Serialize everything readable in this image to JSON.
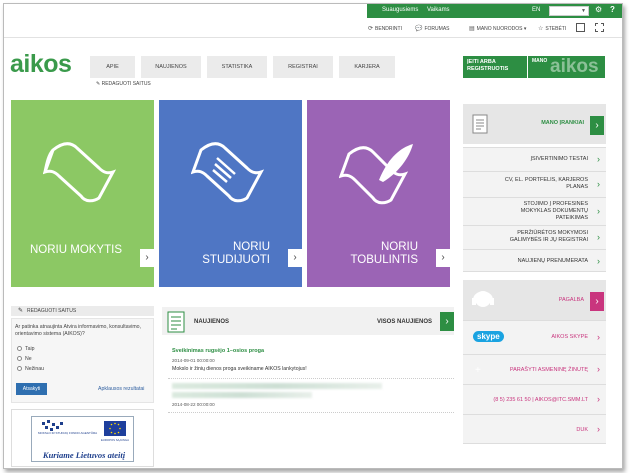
{
  "topbar": {
    "links": [
      "Suaugusiems",
      "Vaikams",
      "EN"
    ],
    "settings_icon": "gear-icon",
    "help_label": "?"
  },
  "subbar": {
    "share_label": "BENDRINTI",
    "forums_label": "FORUMAS",
    "my_links_label": "MANO NUORODOS",
    "follow_label": "STEBĖTI"
  },
  "brand": {
    "logo": "aikos"
  },
  "nav": {
    "items": [
      "APIE",
      "NAUJIENOS",
      "STATISTIKA",
      "REGISTRAI",
      "KARJERA"
    ],
    "edit_label": "REDAGUOTI SAITUS"
  },
  "login": {
    "label": "ĮEITI ARBA REGISTRUOTIS"
  },
  "mano": {
    "label": "MANO",
    "watermark": "aikos"
  },
  "tiles": [
    {
      "title_lines": [
        "NORIU MOKYTIS"
      ],
      "color": "#8cc864"
    },
    {
      "title_lines": [
        "NORIU",
        "STUDIJUOTI"
      ],
      "color": "#4f76c4"
    },
    {
      "title_lines": [
        "NORIU",
        "TOBULINTIS"
      ],
      "color": "#9b64b5"
    }
  ],
  "sidebar": {
    "head_label": "MANO ĮRANKIAI",
    "items": [
      {
        "lines": [
          "ĮSIVERTINIMO TESTAI"
        ]
      },
      {
        "lines": [
          "CV, EL. PORTFELIS, KARJEROS",
          "PLANAS"
        ]
      },
      {
        "lines": [
          "STOJIMO Į PROFESINES",
          "MOKYKLAS DOKUMENTŲ",
          "PATEIKIMAS"
        ]
      },
      {
        "lines": [
          "PERŽIŪRĖTOS MOKYMOSI",
          "GALIMYBĖS IR JŲ REGISTRAI"
        ]
      },
      {
        "lines": [
          "NAUJIENŲ PRENUMERATA"
        ]
      }
    ]
  },
  "help": {
    "head_label": "PAGALBA",
    "items": [
      {
        "label": "AIKOS SKYPE"
      },
      {
        "label": "PARAŠYTI ASMENINĘ ŽINUTĘ"
      },
      {
        "label": "(8 5) 235 61 50 | AIKOS@ITC.SMM.LT"
      },
      {
        "label": "DUK"
      }
    ],
    "skype_logo": "skype"
  },
  "poll": {
    "edit_label": "REDAGUOTI SAITUS",
    "question": "Ar patinka atnaujinta Atvira informavimo, konsultavimo, orientavimo sistema (AIKOS)?",
    "options": [
      "Taip",
      "Ne",
      "Nežinau"
    ],
    "vote_button": "Atsakyti",
    "results_link": "Apklausos rezultatai"
  },
  "banner": {
    "org_name": "MOKSLO IR STUDIJŲ FONDO AGENTŪRA",
    "eu_text": "EUROPOS SĄJUNGA",
    "caption": "Kuriame Lietuvos ateitį"
  },
  "news": {
    "title": "NAUJIENOS",
    "all_label": "VISOS NAUJIENOS",
    "items": [
      {
        "title": "Sveikinimas rugsėjo 1–osios proga",
        "date": "2014-09-01 00:00:00",
        "text": "Mokslo ir žinių dienos proga sveikiname AIKOS lankytojus!"
      },
      {
        "date": "2014-08-22 00:00:00"
      }
    ]
  }
}
